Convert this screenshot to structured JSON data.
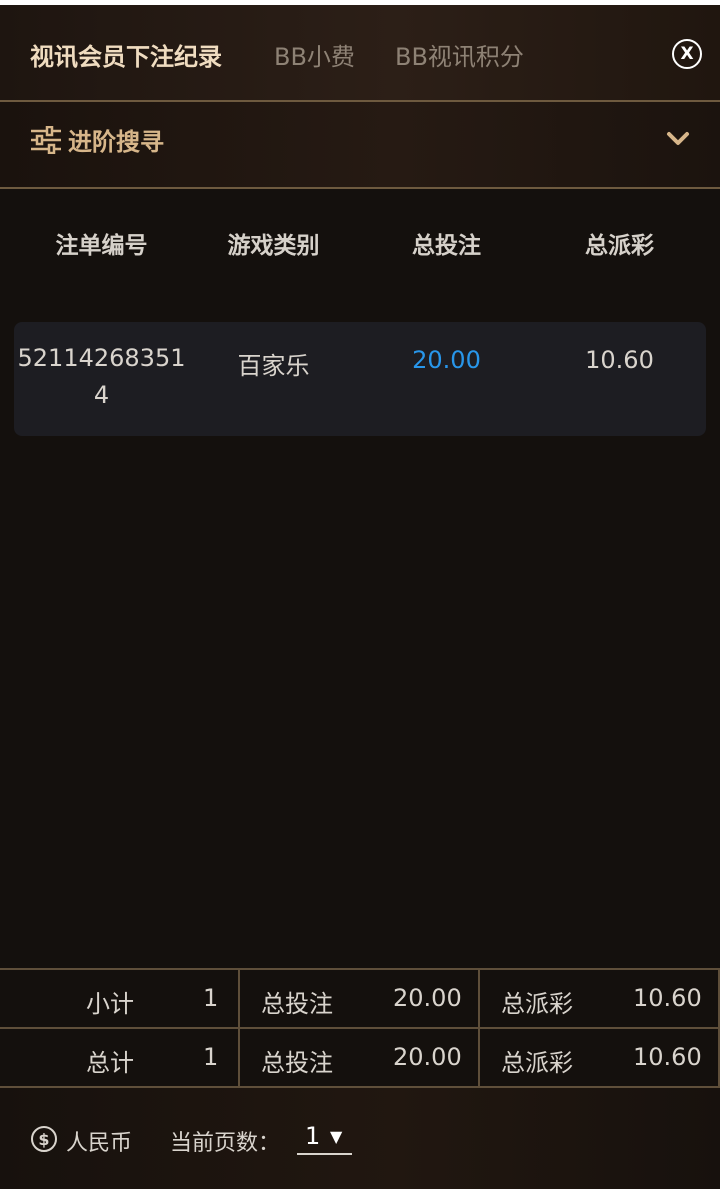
{
  "header": {
    "tabs": [
      {
        "label": "视讯会员下注纪录",
        "active": true
      },
      {
        "label": "BB小费",
        "active": false
      },
      {
        "label": "BB视讯积分",
        "active": false
      }
    ],
    "close_label": "X"
  },
  "search": {
    "label": "进阶搜寻",
    "icon": "sliders-icon",
    "toggle_icon": "chevron-down-icon"
  },
  "table": {
    "columns": [
      "注单编号",
      "游戏类别",
      "总投注",
      "总派彩"
    ],
    "rows": [
      {
        "ticket_id": "521142683514",
        "game": "百家乐",
        "bet": "20.00",
        "payout": "10.60"
      }
    ]
  },
  "summary": {
    "subtotal": {
      "label": "小计",
      "count": "1",
      "bet_label": "总投注",
      "bet": "20.00",
      "payout_label": "总派彩",
      "payout": "10.60"
    },
    "total": {
      "label": "总计",
      "count": "1",
      "bet_label": "总投注",
      "bet": "20.00",
      "payout_label": "总派彩",
      "payout": "10.60"
    }
  },
  "footer": {
    "currency": "人民币",
    "currency_icon": "dollar-coin-icon",
    "page_label": "当前页数：",
    "page_value": "1"
  },
  "colors": {
    "accent_gold": "#d7b68a",
    "bet_blue": "#2896ea",
    "background": "#14100d",
    "divider": "#6e5a3f"
  }
}
